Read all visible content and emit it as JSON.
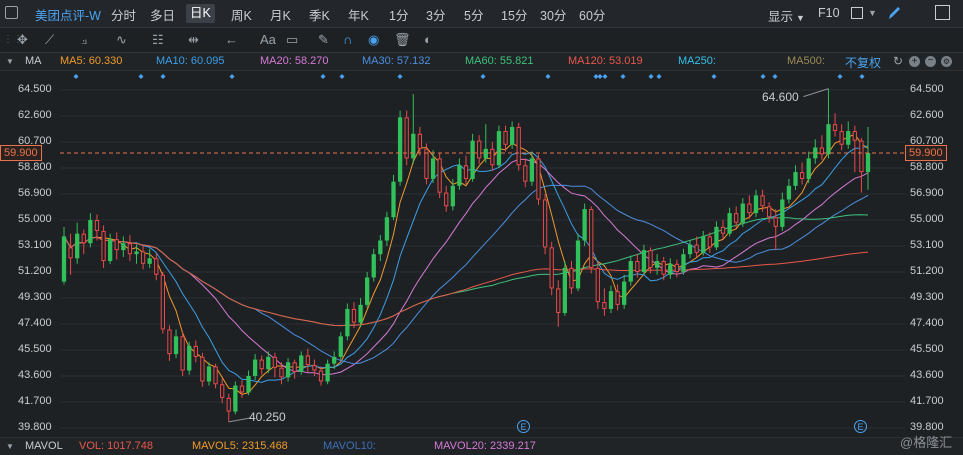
{
  "topbar": {
    "stock_name": "美团点评-W",
    "periods": [
      "分时",
      "多日",
      "日K",
      "周K",
      "月K",
      "季K",
      "年K",
      "1分",
      "3分",
      "5分",
      "15分",
      "30分",
      "60分"
    ],
    "active_period": "日K",
    "display_label": "显示",
    "f10_label": "F10",
    "checkbox_icon": "square-checkbox-icon",
    "brush_icon": "pen-icon",
    "expand_icon": "expand-icon"
  },
  "toolbar": {
    "tools": [
      "move-cross-icon",
      "line-tool-icon",
      "channel-tool-icon",
      "wave-tool-icon",
      "fib-tool-icon",
      "range-tool-icon",
      "arrow-left-icon",
      "text-tool-icon",
      "comment-icon",
      "eraser-icon",
      "magnet-icon",
      "eye-icon",
      "trash-icon",
      "toggle-icon"
    ],
    "text_tool_label": "Aa"
  },
  "ma_bar": {
    "title": "MA",
    "items": [
      {
        "label": "MA5: 60.330",
        "color": "#f09a2a"
      },
      {
        "label": "MA10: 60.095",
        "color": "#3aa0e8"
      },
      {
        "label": "MA20: 58.270",
        "color": "#d67ad6"
      },
      {
        "label": "MA30: 57.132",
        "color": "#4b8fe0"
      },
      {
        "label": "MA60: 55.821",
        "color": "#3ec27c"
      },
      {
        "label": "MA120: 53.019",
        "color": "#e8584a"
      },
      {
        "label": "MA250:",
        "color": "#33c1e8"
      },
      {
        "label": "MA500:",
        "color": "#9a8a55"
      }
    ],
    "adjust_label": "不复权"
  },
  "chart_data": {
    "type": "candlestick",
    "y_ticks": [
      64.5,
      62.6,
      60.7,
      58.8,
      56.9,
      55.0,
      53.1,
      51.2,
      49.3,
      47.4,
      45.5,
      43.6,
      41.7,
      39.8
    ],
    "y_tick_labels": [
      "64.500",
      "62.600",
      "60.700",
      "58.800",
      "56.900",
      "55.000",
      "53.100",
      "51.200",
      "49.300",
      "47.400",
      "45.500",
      "43.600",
      "41.700",
      "39.800"
    ],
    "ylim": [
      39.8,
      64.5
    ],
    "current_price_label": "59.900",
    "current_price": 59.9,
    "high_label": "64.600",
    "low_label": "40.250",
    "up_color": "#32c05a",
    "down_color": "#e84a4a",
    "event_markers": [
      "E",
      "E"
    ],
    "ohlc": [
      [
        50.5,
        53.8,
        50.3,
        54.5
      ],
      [
        53.0,
        52.2,
        51.0,
        54.0
      ],
      [
        52.2,
        54.0,
        51.8,
        54.8
      ],
      [
        54.0,
        53.3,
        52.5,
        54.3
      ],
      [
        53.3,
        55.0,
        53.0,
        55.5
      ],
      [
        55.0,
        54.2,
        53.5,
        55.4
      ],
      [
        54.2,
        52.0,
        51.5,
        54.6
      ],
      [
        52.0,
        53.6,
        51.8,
        54.0
      ],
      [
        53.6,
        52.8,
        52.1,
        54.1
      ],
      [
        52.8,
        53.3,
        52.3,
        53.8
      ],
      [
        53.3,
        52.5,
        52.0,
        53.9
      ],
      [
        52.5,
        52.7,
        51.8,
        53.2
      ],
      [
        52.7,
        51.8,
        51.4,
        53.1
      ],
      [
        51.8,
        52.2,
        51.5,
        52.9
      ],
      [
        52.2,
        51.0,
        50.6,
        52.6
      ],
      [
        51.0,
        47.0,
        46.7,
        51.2
      ],
      [
        47.0,
        45.2,
        44.7,
        47.3
      ],
      [
        45.2,
        46.5,
        44.9,
        47.0
      ],
      [
        46.5,
        44.0,
        43.6,
        46.8
      ],
      [
        44.0,
        45.8,
        43.7,
        46.1
      ],
      [
        45.8,
        45.0,
        44.6,
        46.2
      ],
      [
        45.0,
        43.2,
        42.8,
        45.3
      ],
      [
        43.2,
        44.3,
        42.9,
        44.6
      ],
      [
        44.3,
        43.0,
        42.7,
        44.5
      ],
      [
        43.0,
        42.0,
        41.6,
        43.4
      ],
      [
        42.0,
        41.0,
        40.25,
        42.3
      ],
      [
        41.0,
        42.9,
        40.8,
        43.2
      ],
      [
        42.9,
        42.4,
        42.0,
        43.3
      ],
      [
        42.4,
        43.6,
        42.2,
        44.0
      ],
      [
        43.6,
        44.8,
        43.3,
        45.2
      ],
      [
        44.8,
        44.1,
        43.7,
        45.1
      ],
      [
        44.1,
        45.0,
        43.8,
        45.4
      ],
      [
        45.0,
        44.2,
        43.5,
        45.3
      ],
      [
        44.2,
        43.5,
        43.0,
        44.6
      ],
      [
        43.5,
        44.6,
        43.2,
        44.9
      ],
      [
        44.6,
        43.9,
        43.4,
        44.8
      ],
      [
        43.9,
        45.1,
        43.7,
        45.4
      ],
      [
        45.1,
        44.4,
        43.9,
        45.6
      ],
      [
        44.4,
        44.0,
        43.6,
        44.8
      ],
      [
        44.0,
        43.2,
        42.9,
        44.3
      ],
      [
        43.2,
        44.5,
        43.0,
        44.8
      ],
      [
        44.5,
        45.0,
        44.1,
        45.4
      ],
      [
        45.0,
        46.5,
        44.8,
        46.8
      ],
      [
        46.5,
        48.5,
        46.2,
        48.9
      ],
      [
        48.5,
        47.5,
        47.1,
        49.0
      ],
      [
        47.5,
        48.8,
        47.2,
        49.3
      ],
      [
        48.8,
        50.8,
        48.6,
        51.2
      ],
      [
        50.8,
        52.5,
        50.5,
        52.9
      ],
      [
        52.5,
        53.5,
        52.0,
        53.9
      ],
      [
        53.5,
        55.2,
        53.1,
        55.6
      ],
      [
        55.2,
        57.8,
        55.0,
        58.3
      ],
      [
        57.8,
        62.5,
        57.5,
        63.0
      ],
      [
        62.5,
        59.5,
        59.0,
        63.0
      ],
      [
        59.5,
        61.3,
        59.1,
        64.2
      ],
      [
        61.3,
        60.2,
        59.7,
        61.8
      ],
      [
        60.2,
        58.0,
        57.6,
        60.6
      ],
      [
        58.0,
        59.5,
        57.7,
        60.1
      ],
      [
        59.5,
        57.0,
        56.6,
        59.9
      ],
      [
        57.0,
        56.0,
        55.6,
        57.5
      ],
      [
        56.0,
        57.5,
        55.7,
        58.0
      ],
      [
        57.5,
        59.0,
        57.2,
        59.5
      ],
      [
        59.0,
        58.0,
        57.6,
        59.7
      ],
      [
        58.0,
        60.8,
        57.8,
        61.3
      ],
      [
        60.8,
        59.5,
        59.1,
        61.2
      ],
      [
        59.5,
        60.2,
        59.2,
        62.0
      ],
      [
        60.2,
        59.0,
        58.6,
        60.7
      ],
      [
        59.0,
        61.5,
        58.8,
        61.9
      ],
      [
        61.5,
        60.5,
        60.0,
        61.9
      ],
      [
        60.5,
        61.8,
        60.2,
        62.2
      ],
      [
        61.8,
        59.0,
        58.6,
        62.1
      ],
      [
        59.0,
        57.8,
        57.4,
        59.5
      ],
      [
        57.8,
        59.5,
        57.5,
        60.0
      ],
      [
        59.5,
        56.5,
        56.1,
        59.8
      ],
      [
        56.5,
        53.0,
        52.5,
        56.9
      ],
      [
        53.0,
        50.0,
        49.5,
        53.4
      ],
      [
        50.0,
        48.2,
        47.2,
        50.6
      ],
      [
        48.2,
        51.5,
        48.0,
        52.0
      ],
      [
        51.5,
        50.0,
        49.6,
        52.0
      ],
      [
        50.0,
        53.5,
        49.8,
        54.0
      ],
      [
        53.5,
        55.8,
        53.1,
        56.2
      ],
      [
        55.8,
        51.5,
        51.1,
        56.0
      ],
      [
        51.5,
        49.0,
        48.5,
        51.9
      ],
      [
        49.0,
        48.5,
        48.0,
        50.0
      ],
      [
        48.5,
        49.8,
        48.2,
        50.2
      ],
      [
        49.8,
        48.8,
        48.4,
        50.3
      ],
      [
        48.8,
        50.5,
        48.5,
        51.0
      ],
      [
        50.5,
        52.0,
        50.2,
        52.4
      ],
      [
        52.0,
        51.2,
        50.8,
        52.5
      ],
      [
        51.2,
        52.8,
        51.0,
        53.2
      ],
      [
        52.8,
        51.5,
        51.1,
        53.0
      ],
      [
        51.5,
        52.0,
        51.0,
        52.5
      ],
      [
        52.0,
        51.0,
        50.6,
        52.3
      ],
      [
        51.0,
        51.8,
        50.7,
        52.2
      ],
      [
        51.8,
        51.2,
        50.8,
        52.1
      ],
      [
        51.2,
        52.5,
        51.0,
        52.9
      ],
      [
        52.5,
        53.2,
        52.2,
        53.5
      ],
      [
        53.2,
        52.6,
        52.3,
        53.8
      ],
      [
        52.6,
        53.8,
        52.4,
        54.2
      ],
      [
        53.8,
        53.0,
        52.6,
        54.1
      ],
      [
        53.0,
        54.5,
        52.8,
        54.9
      ],
      [
        54.5,
        54.0,
        53.6,
        55.0
      ],
      [
        54.0,
        55.5,
        53.8,
        55.9
      ],
      [
        55.5,
        54.8,
        54.4,
        56.0
      ],
      [
        54.8,
        56.2,
        54.5,
        56.6
      ],
      [
        56.2,
        55.5,
        55.1,
        56.8
      ],
      [
        55.5,
        56.8,
        55.2,
        57.2
      ],
      [
        56.8,
        56.0,
        55.6,
        57.2
      ],
      [
        56.0,
        55.2,
        54.8,
        56.3
      ],
      [
        55.2,
        54.5,
        52.8,
        55.8
      ],
      [
        54.5,
        56.5,
        54.2,
        57.0
      ],
      [
        56.5,
        57.5,
        56.2,
        58.0
      ],
      [
        57.5,
        58.5,
        57.2,
        59.0
      ],
      [
        58.5,
        58.0,
        57.6,
        59.2
      ],
      [
        58.0,
        59.5,
        57.7,
        60.0
      ],
      [
        59.5,
        60.3,
        59.1,
        60.9
      ],
      [
        60.3,
        59.8,
        59.4,
        61.2
      ],
      [
        59.8,
        62.0,
        59.5,
        64.6
      ],
      [
        62.0,
        61.5,
        61.1,
        62.8
      ],
      [
        61.5,
        60.5,
        60.1,
        62.0
      ],
      [
        60.5,
        61.5,
        60.2,
        62.2
      ],
      [
        61.5,
        60.8,
        58.5,
        61.9
      ],
      [
        60.8,
        58.5,
        57.0,
        61.0
      ],
      [
        58.5,
        59.9,
        57.2,
        61.8
      ]
    ]
  },
  "volume_bar": {
    "title": "MAVOL",
    "items": [
      {
        "label": "VOL: 1017.748",
        "color": "#e8584a"
      },
      {
        "label": "MAVOL5: 2315.468",
        "color": "#f09a2a"
      },
      {
        "label": "MAVOL10:",
        "color": "#3a6fb8"
      },
      {
        "label": "MAVOL20: 2339.217",
        "color": "#d67ad6"
      }
    ],
    "watermark": "格隆汇"
  }
}
